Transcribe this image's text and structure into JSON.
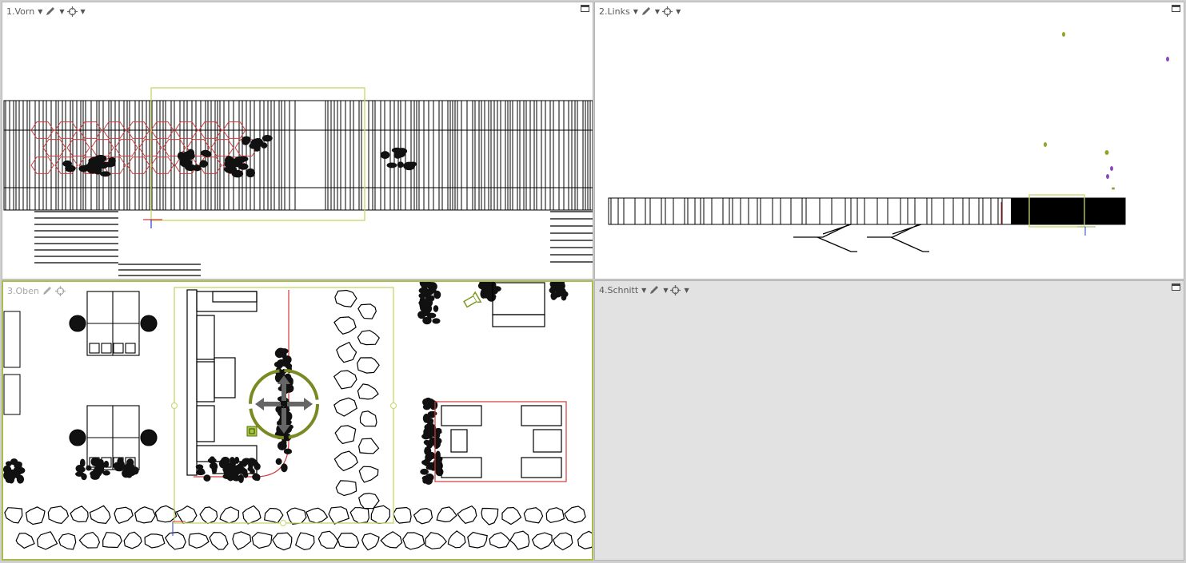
{
  "viewports": [
    {
      "id": "1",
      "title": "1.Vorn",
      "view": "front"
    },
    {
      "id": "2",
      "title": "2.Links",
      "view": "left"
    },
    {
      "id": "3",
      "title": "3.Oben",
      "view": "top"
    },
    {
      "id": "4",
      "title": "4.Schnitt",
      "view": "perspective-section"
    }
  ],
  "icons": {
    "display_mode": "pencil-icon",
    "camera_menu": "crosshair-icon",
    "dropdown": "caret-down-icon",
    "maximize": "maximize-icon"
  },
  "colors": {
    "selection": "#a8bd4a",
    "gizmo": "#7a8a22",
    "red_lines": "#d23a3a",
    "floor": "#3a3a3a",
    "wood": "#6b4a32",
    "plants": "#6fae2e"
  },
  "active_viewport": "3"
}
